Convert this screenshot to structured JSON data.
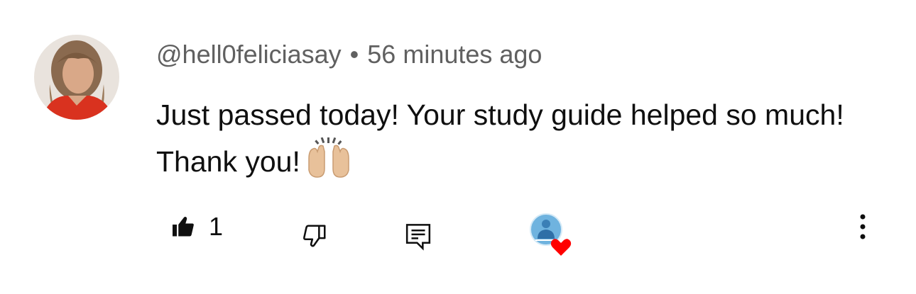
{
  "comment": {
    "author": "@hell0feliciasay",
    "separator": "•",
    "time": "56 minutes ago",
    "text": "Just passed today! Your study guide helped so much! Thank you!",
    "emoji": "raising-hands-emoji"
  },
  "actions": {
    "like_count": "1",
    "like_icon": "thumbs-up-filled-icon",
    "dislike_icon": "thumbs-down-icon",
    "reply_icon": "reply-comment-icon",
    "creator_heart_icon": "creator-heart-icon",
    "more_icon": "more-vertical-icon"
  },
  "colors": {
    "meta_text": "#606060",
    "body_text": "#0f0f0f",
    "heart": "#ff0000"
  }
}
